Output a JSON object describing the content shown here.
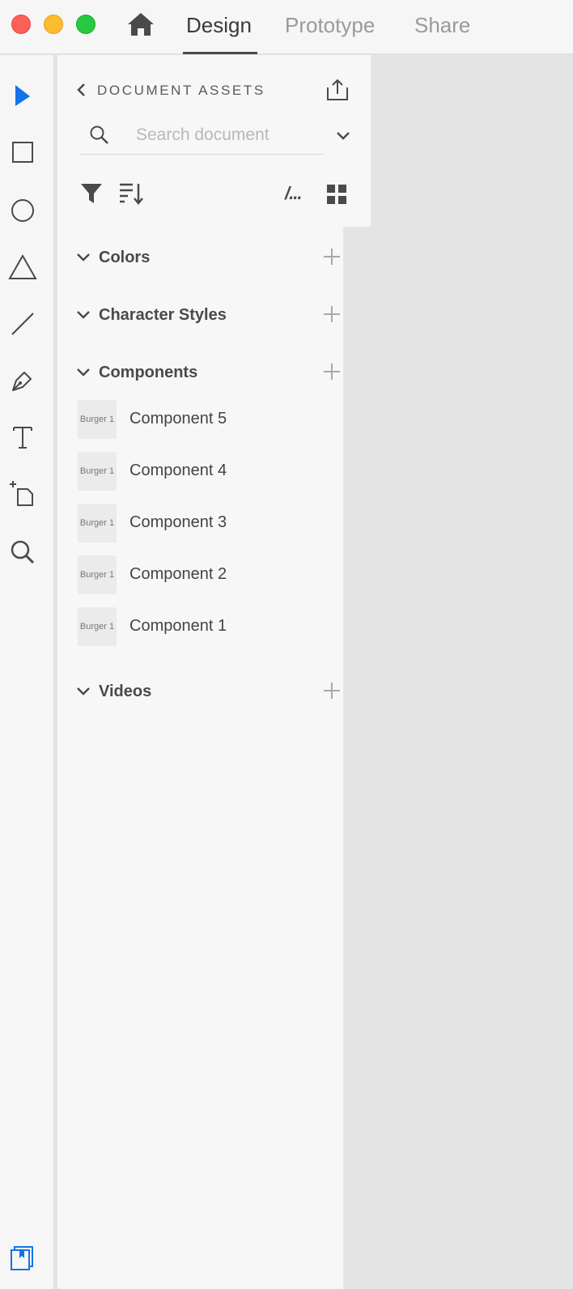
{
  "window": {
    "tabs": [
      {
        "label": "Design",
        "active": true
      },
      {
        "label": "Prototype",
        "active": false
      },
      {
        "label": "Share",
        "active": false
      }
    ],
    "home_icon": "home-icon"
  },
  "toolbar": {
    "tools": [
      "select-tool",
      "rectangle-tool",
      "ellipse-tool",
      "polygon-tool",
      "line-tool",
      "pen-tool",
      "text-tool",
      "artboard-tool",
      "zoom-tool"
    ],
    "selected_tool": "select-tool",
    "accent": "#1473e6"
  },
  "assets": {
    "title": "DOCUMENT ASSETS",
    "search": {
      "placeholder": "Search document",
      "value": ""
    },
    "view_path_label": "/...",
    "sections": {
      "colors": {
        "label": "Colors"
      },
      "character_styles": {
        "label": "Character Styles"
      },
      "components": {
        "label": "Components",
        "items": [
          {
            "thumb": "Burger 1",
            "name": "Component 5"
          },
          {
            "thumb": "Burger 1",
            "name": "Component 4"
          },
          {
            "thumb": "Burger 1",
            "name": "Component 3"
          },
          {
            "thumb": "Burger 1",
            "name": "Component 2"
          },
          {
            "thumb": "Burger 1",
            "name": "Component 1"
          }
        ]
      },
      "videos": {
        "label": "Videos"
      }
    }
  }
}
